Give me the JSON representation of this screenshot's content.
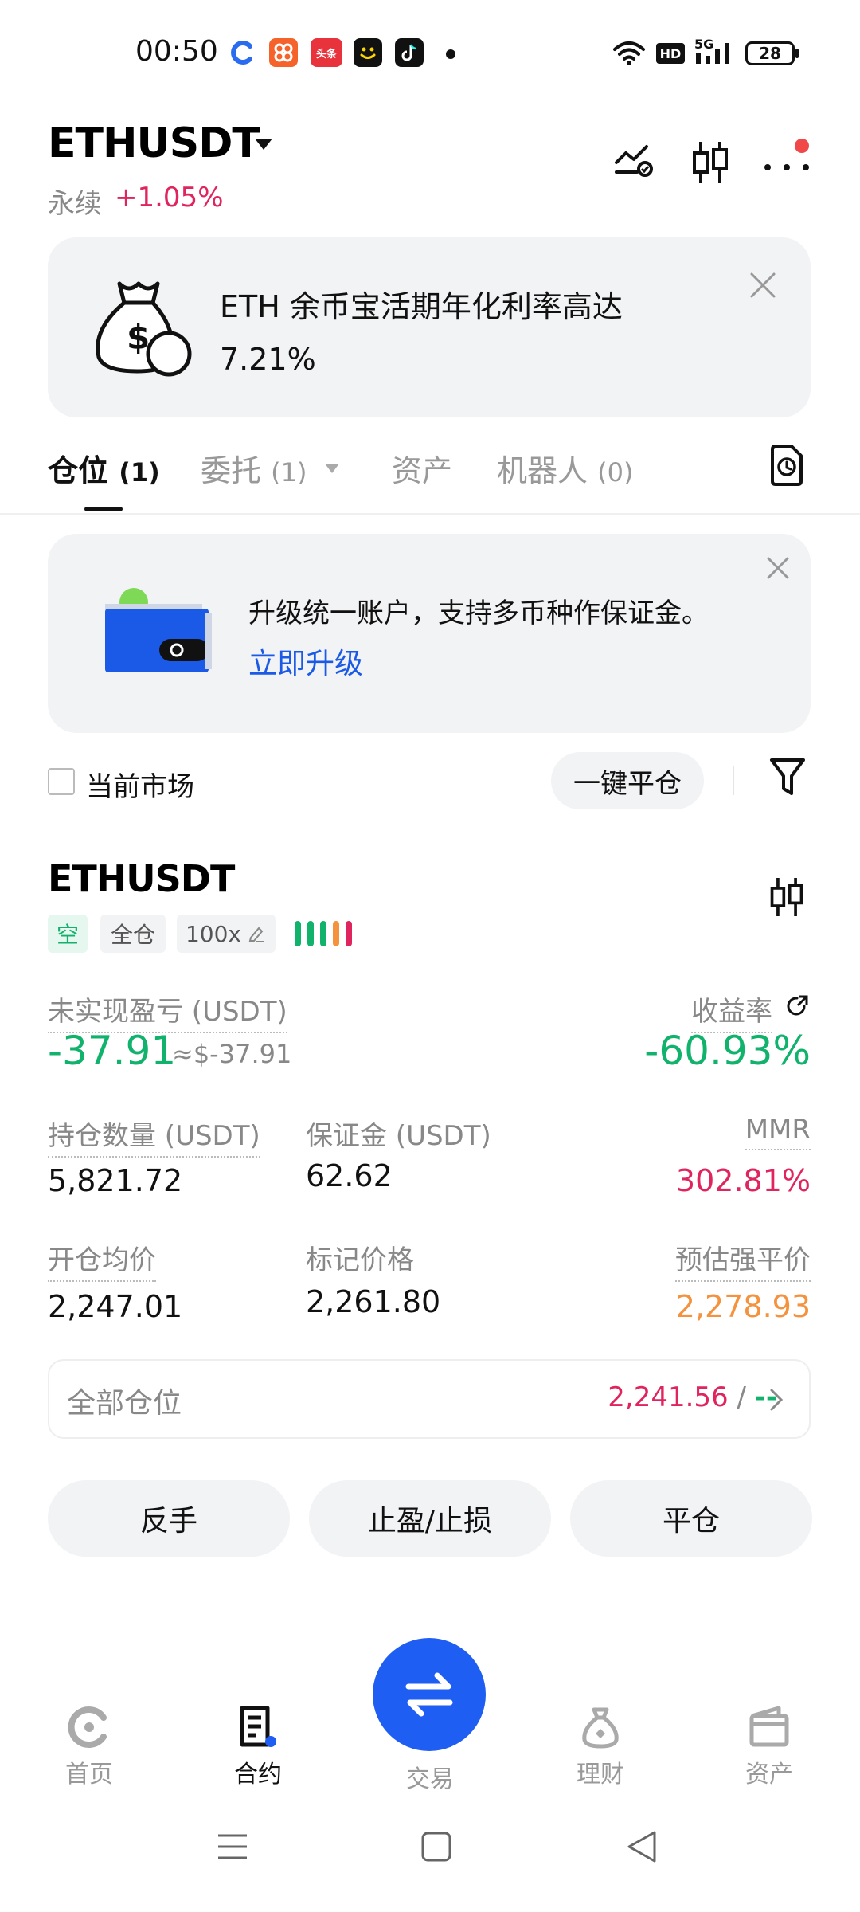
{
  "status_bar": {
    "time": "00:50",
    "battery": "28",
    "network": "5G",
    "hd": "HD",
    "app_icon_text": "头条"
  },
  "header": {
    "symbol": "ETHUSDT",
    "type": "永续",
    "change": "+1.05%"
  },
  "promo": {
    "line1": "ETH 余币宝活期年化利率高达",
    "line2": "7.21%"
  },
  "tabs": [
    {
      "label": "仓位",
      "count": "(1)"
    },
    {
      "label": "委托",
      "count": "(1)"
    },
    {
      "label": "资产",
      "count": ""
    },
    {
      "label": "机器人",
      "count": "(0)"
    }
  ],
  "upgrade": {
    "text": "升级统一账户，支持多币种作保证金。",
    "link": "立即升级"
  },
  "filter": {
    "current_market": "当前市场",
    "close_all": "一键平仓"
  },
  "position": {
    "symbol": "ETHUSDT",
    "side": "空",
    "margin_mode": "全仓",
    "leverage": "100x",
    "adl_bars": [
      "#10b26c",
      "#10b26c",
      "#10b26c",
      "#f5923e",
      "#e0245e"
    ],
    "upnl_label": "未实现盈亏 (USDT)",
    "upnl": "-37.91",
    "upnl_usd": "≈$-37.91",
    "roe_label": "收益率",
    "roe": "-60.93%",
    "size_label": "持仓数量 (USDT)",
    "size": "5,821.72",
    "margin_label": "保证金 (USDT)",
    "margin": "62.62",
    "mmr_label": "MMR",
    "mmr": "302.81%",
    "entry_label": "开仓均价",
    "entry": "2,247.01",
    "mark_label": "标记价格",
    "mark": "2,261.80",
    "liq_label": "预估强平价",
    "liq": "2,278.93"
  },
  "all_positions": {
    "label": "全部仓位",
    "value": "2,241.56",
    "sep": "/",
    "dash": "--"
  },
  "actions": {
    "reverse": "反手",
    "tp_sl": "止盈/止损",
    "close": "平仓"
  },
  "nav": {
    "home": "首页",
    "contract": "合约",
    "trade": "交易",
    "finance": "理财",
    "assets": "资产"
  },
  "colors": {
    "accent": "#1f5ef2",
    "up_green": "#10b26c",
    "down_red": "#e0245e",
    "orange": "#f5923e"
  }
}
